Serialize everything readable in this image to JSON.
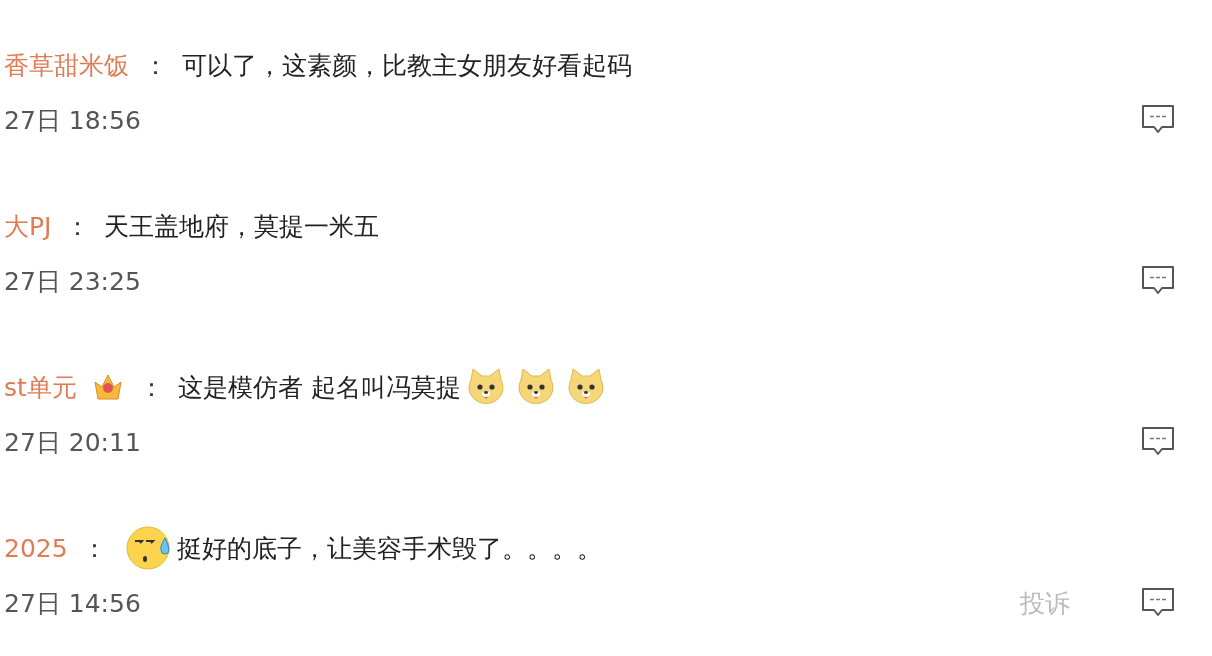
{
  "comments": [
    {
      "name": "香草甜米饭",
      "vip_badge": false,
      "separator": "：",
      "content": [
        {
          "kind": "text",
          "text": "可以了，这素颜，比教主女朋友好看起码"
        }
      ],
      "time": "27日 18:56"
    },
    {
      "name": "大PJ",
      "vip_badge": false,
      "separator": "：",
      "content": [
        {
          "kind": "text",
          "text": "天王盖地府，莫提一米五"
        }
      ],
      "time": "27日 23:25"
    },
    {
      "name": "st单元",
      "vip_badge": true,
      "separator": "：",
      "content": [
        {
          "kind": "text",
          "text": "这是模仿者 起名叫冯莫提"
        },
        {
          "kind": "doge"
        },
        {
          "kind": "doge"
        },
        {
          "kind": "doge"
        }
      ],
      "time": "27日 20:11"
    },
    {
      "name": "2025",
      "vip_badge": false,
      "separator": "：",
      "content": [
        {
          "kind": "sweat"
        },
        {
          "kind": "text",
          "text": "挺好的底子，让美容手术毁了。。。。"
        }
      ],
      "time": "27日 14:56",
      "report": "投诉"
    }
  ]
}
